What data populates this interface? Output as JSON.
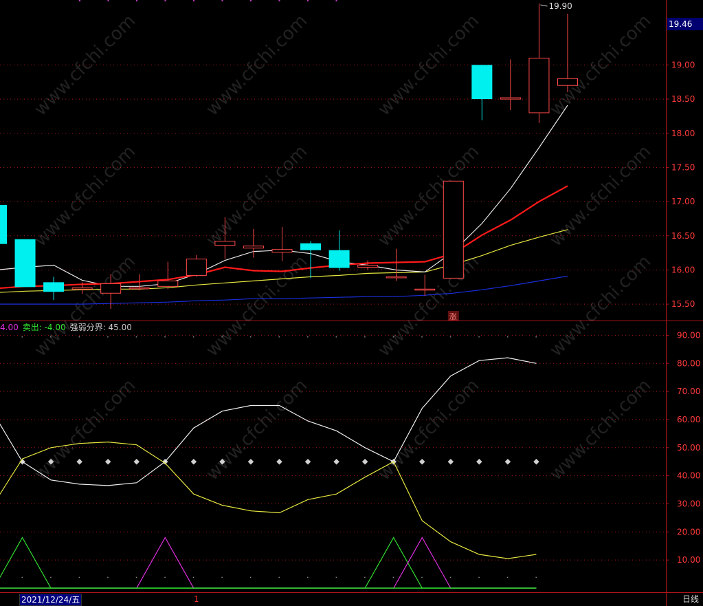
{
  "colors": {
    "background": "#000000",
    "axis_red": "#b0161d",
    "up_candle": "#ff4a4a",
    "down_candle": "#00f0f0",
    "ma_white": "#e8e8e8",
    "ma_red": "#ff1a1a",
    "ma_yellow": "#e6e640",
    "ma_blue": "#1a2fe0",
    "ind_white": "#eeeeee",
    "ind_yellow": "#e6e640",
    "ind_green": "#30e030",
    "ind_magenta": "#e030e0",
    "dot_grey": "#d0d0d0",
    "legend_magenta": "#e030e0",
    "legend_green": "#30e030",
    "legend_grey": "#c8c8c8"
  },
  "watermark": "www.cfchi.com",
  "price_tag": "19.46",
  "legend": {
    "buy": "4.00",
    "sell_label": "卖出:",
    "sell_value": " -4.00",
    "boundary": "强弱分界: 45.00"
  },
  "bottom": {
    "date": "2021/12/24/五",
    "cursor": "1",
    "period": "日线"
  },
  "chart_data": [
    {
      "type": "candlestick",
      "ylim": [
        15.27,
        19.95
      ],
      "yticks": [
        "19.00",
        "18.50",
        "18.00",
        "17.50",
        "17.00",
        "16.50",
        "16.00",
        "15.50"
      ],
      "high_label": "19.90",
      "annotation": "涨",
      "candles": [
        {
          "o": 16.95,
          "c": 16.38,
          "h": 16.95,
          "l": 16.38,
          "up": false
        },
        {
          "o": 16.45,
          "c": 15.75,
          "h": 16.45,
          "l": 15.75,
          "up": false
        },
        {
          "o": 15.82,
          "c": 15.68,
          "h": 15.9,
          "l": 15.56,
          "up": false
        },
        {
          "o": 15.72,
          "c": 15.74,
          "h": 15.82,
          "l": 15.65,
          "up": true
        },
        {
          "o": 15.66,
          "c": 15.8,
          "h": 15.94,
          "l": 15.43,
          "up": true
        },
        {
          "o": 15.73,
          "c": 15.74,
          "h": 15.94,
          "l": 15.7,
          "up": true
        },
        {
          "o": 15.76,
          "c": 15.84,
          "h": 16.12,
          "l": 15.72,
          "up": true
        },
        {
          "o": 15.92,
          "c": 16.16,
          "h": 16.22,
          "l": 15.9,
          "up": true
        },
        {
          "o": 16.36,
          "c": 16.42,
          "h": 16.77,
          "l": 16.16,
          "up": true
        },
        {
          "o": 16.32,
          "c": 16.35,
          "h": 16.6,
          "l": 16.18,
          "up": true
        },
        {
          "o": 16.26,
          "c": 16.3,
          "h": 16.63,
          "l": 16.13,
          "up": true
        },
        {
          "o": 16.39,
          "c": 16.29,
          "h": 16.42,
          "l": 15.88,
          "up": false
        },
        {
          "o": 16.29,
          "c": 16.03,
          "h": 16.58,
          "l": 15.99,
          "up": false
        },
        {
          "o": 16.04,
          "c": 16.07,
          "h": 16.14,
          "l": 16.0,
          "up": true
        },
        {
          "o": 15.9,
          "c": 15.89,
          "h": 16.31,
          "l": 15.84,
          "up": true
        },
        {
          "o": 15.71,
          "c": 15.72,
          "h": 15.93,
          "l": 15.62,
          "up": true
        },
        {
          "o": 15.88,
          "c": 17.3,
          "h": 17.3,
          "l": 15.88,
          "up": true
        },
        {
          "o": 19.0,
          "c": 18.5,
          "h": 19.0,
          "l": 18.19,
          "up": false
        },
        {
          "o": 18.5,
          "c": 18.52,
          "h": 19.08,
          "l": 18.34,
          "up": true
        },
        {
          "o": 18.3,
          "c": 19.1,
          "h": 19.9,
          "l": 18.15,
          "up": true
        },
        {
          "o": 18.7,
          "c": 18.8,
          "h": 19.75,
          "l": 18.6,
          "up": true
        }
      ],
      "ma_white": [
        16.0,
        16.04,
        16.07,
        15.85,
        15.76,
        15.76,
        15.8,
        15.94,
        16.14,
        16.27,
        16.29,
        16.24,
        16.12,
        16.07,
        16.0,
        15.97,
        16.27,
        16.68,
        17.19,
        17.79,
        18.41
      ],
      "ma_red": [
        15.73,
        15.76,
        15.77,
        15.79,
        15.8,
        15.83,
        15.86,
        15.93,
        16.04,
        15.99,
        15.98,
        16.03,
        16.07,
        16.1,
        16.11,
        16.12,
        16.24,
        16.51,
        16.73,
        17.0,
        17.23
      ],
      "ma_yellow": [
        15.67,
        15.69,
        15.7,
        15.71,
        15.72,
        15.72,
        15.74,
        15.78,
        15.81,
        15.84,
        15.87,
        15.9,
        15.92,
        15.95,
        15.96,
        15.97,
        16.08,
        16.21,
        16.36,
        16.48,
        16.59
      ],
      "ma_blue": [
        15.5,
        15.5,
        15.5,
        15.5,
        15.51,
        15.52,
        15.53,
        15.55,
        15.56,
        15.58,
        15.58,
        15.59,
        15.6,
        15.61,
        15.61,
        15.63,
        15.66,
        15.71,
        15.77,
        15.84,
        15.91
      ]
    },
    {
      "type": "line",
      "ylim": [
        0,
        95
      ],
      "yticks": [
        "90.00",
        "80.00",
        "70.00",
        "60.00",
        "50.00",
        "40.00",
        "30.00",
        "20.00",
        "10.00"
      ],
      "boundary": 45,
      "white": [
        62,
        45,
        38.5,
        37,
        36.5,
        37.5,
        45,
        57,
        63,
        65,
        65,
        59.5,
        56,
        50,
        45,
        64,
        75.5,
        81,
        82,
        80
      ],
      "yellow": [
        30,
        46,
        50,
        51.5,
        52,
        51,
        44.5,
        33.5,
        29.5,
        27.5,
        26.8,
        31.5,
        33.5,
        39.5,
        45,
        24,
        16.5,
        12,
        10.5,
        12
      ],
      "green": [
        0,
        18,
        0,
        0,
        0,
        0,
        0,
        0,
        0,
        0,
        0,
        0,
        0,
        0,
        18,
        0,
        0,
        0,
        0,
        0
      ],
      "magenta": [
        0,
        0,
        0,
        0,
        0,
        0,
        18,
        0,
        0,
        0,
        0,
        0,
        0,
        0,
        0,
        18,
        0,
        0,
        0,
        0
      ]
    }
  ]
}
